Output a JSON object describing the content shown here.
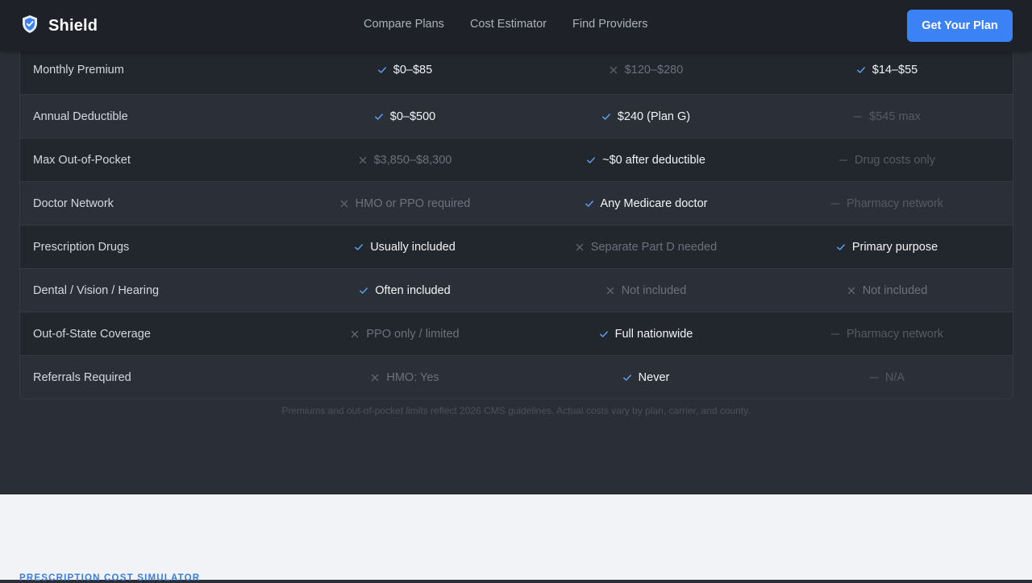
{
  "header": {
    "brand": "Shield",
    "nav": [
      "Compare Plans",
      "Cost Estimator",
      "Find Providers"
    ],
    "cta": "Get Your Plan"
  },
  "comparison": {
    "rows": [
      {
        "label": "Monthly Premium",
        "cells": [
          {
            "status": "yes",
            "text": "$0–$85"
          },
          {
            "status": "no",
            "text": "$120–$280"
          },
          {
            "status": "yes",
            "text": "$14–$55"
          }
        ]
      },
      {
        "label": "Annual Deductible",
        "cells": [
          {
            "status": "yes",
            "text": "$0–$500"
          },
          {
            "status": "yes",
            "text": "$240 (Plan G)"
          },
          {
            "status": "na",
            "text": "$545 max"
          }
        ]
      },
      {
        "label": "Max Out-of-Pocket",
        "cells": [
          {
            "status": "no",
            "text": "$3,850–$8,300"
          },
          {
            "status": "yes",
            "text": "~$0 after deductible"
          },
          {
            "status": "na",
            "text": "Drug costs only"
          }
        ]
      },
      {
        "label": "Doctor Network",
        "cells": [
          {
            "status": "no",
            "text": "HMO or PPO required"
          },
          {
            "status": "yes",
            "text": "Any Medicare doctor"
          },
          {
            "status": "na",
            "text": "Pharmacy network"
          }
        ]
      },
      {
        "label": "Prescription Drugs",
        "cells": [
          {
            "status": "yes",
            "text": "Usually included"
          },
          {
            "status": "no",
            "text": "Separate Part D needed"
          },
          {
            "status": "yes",
            "text": "Primary purpose"
          }
        ]
      },
      {
        "label": "Dental / Vision / Hearing",
        "cells": [
          {
            "status": "yes",
            "text": "Often included"
          },
          {
            "status": "no",
            "text": "Not included"
          },
          {
            "status": "no",
            "text": "Not included"
          }
        ]
      },
      {
        "label": "Out-of-State Coverage",
        "cells": [
          {
            "status": "no",
            "text": "PPO only / limited"
          },
          {
            "status": "yes",
            "text": "Full nationwide"
          },
          {
            "status": "na",
            "text": "Pharmacy network"
          }
        ]
      },
      {
        "label": "Referrals Required",
        "cells": [
          {
            "status": "no",
            "text": "HMO: Yes"
          },
          {
            "status": "yes",
            "text": "Never"
          },
          {
            "status": "na",
            "text": "N/A"
          }
        ]
      }
    ],
    "footnote": "Premiums and out-of-pocket limits reflect 2026 CMS guidelines. Actual costs vary by plan, carrier, and county."
  },
  "simulator": {
    "eyebrow": "PRESCRIPTION COST SIMULATOR"
  },
  "colors": {
    "accent": "#3b82f6",
    "check": "#5aa0ee",
    "cross": "#5f6670",
    "dash": "#4e555f"
  },
  "icons": {
    "brand": "shield-icon",
    "yes": "check-icon",
    "no": "x-icon",
    "na": "dash-icon"
  }
}
